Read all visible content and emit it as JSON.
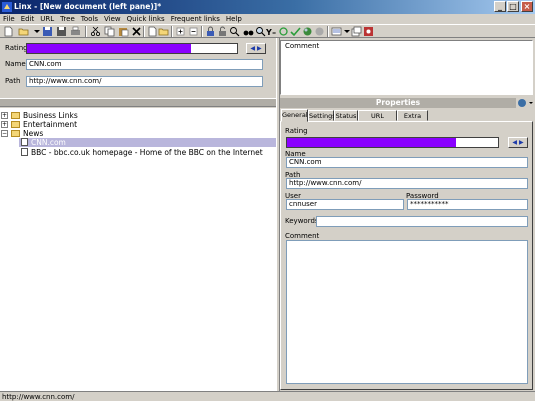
{
  "window": {
    "title": "Linx - [New document (left pane)]*",
    "buttons": {
      "minimize": "_",
      "maximize": "□",
      "close": "×"
    }
  },
  "menu": [
    "File",
    "Edit",
    "URL",
    "Tree",
    "Tools",
    "View",
    "Quick links",
    "Frequent links",
    "Help"
  ],
  "top_editor": {
    "rating_label": "Rating",
    "rating_fraction": 0.78,
    "name_label": "Name",
    "name_value": "CNN.com",
    "path_label": "Path",
    "path_value": "http://www.cnn.com/",
    "comment_label": "Comment"
  },
  "tree": {
    "items": [
      {
        "label": "Business Links",
        "type": "folder",
        "expander": "+"
      },
      {
        "label": "Entertainment",
        "type": "folder",
        "expander": "+"
      },
      {
        "label": "News",
        "type": "folder",
        "expander": "−"
      },
      {
        "label": "CNN.com",
        "type": "link",
        "selected": true
      },
      {
        "label": "BBC - bbc.co.uk homepage - Home of the BBC on the Internet",
        "type": "link"
      }
    ]
  },
  "properties": {
    "header": "Properties",
    "tabs": [
      "General",
      "Settings",
      "Status",
      "URL Header",
      "Extra info"
    ],
    "active_tab": "General",
    "rating_label": "Rating",
    "rating_fraction": 0.8,
    "name_label": "Name",
    "name_value": "CNN.com",
    "path_label": "Path",
    "path_value": "http://www.cnn.com/",
    "user_label": "User",
    "user_value": "cnnuser",
    "password_label": "Password",
    "password_value": "***********",
    "keywords_label": "Keywords:",
    "keywords_value": "",
    "comment_label": "Comment",
    "comment_value": ""
  },
  "status": {
    "text": "http://www.cnn.com/"
  },
  "colors": {
    "rating_fill": "#8a00ff",
    "selection": "#b9b6dc",
    "titlebar": "#0a246a"
  },
  "icons": [
    "app-icon",
    "new-icon",
    "open-icon",
    "save-icon",
    "save-all-icon",
    "print-icon",
    "cut-icon",
    "copy-icon",
    "paste-icon",
    "delete-icon",
    "new-folder-icon",
    "new-link-icon",
    "expand-icon",
    "collapse-icon",
    "lock-icon",
    "unlock-icon",
    "find-icon",
    "search-icon",
    "binoculars-icon",
    "text-icon",
    "refresh-icon",
    "check-icon",
    "web-icon",
    "stop-icon",
    "view-icon",
    "window-icon",
    "options-icon"
  ]
}
